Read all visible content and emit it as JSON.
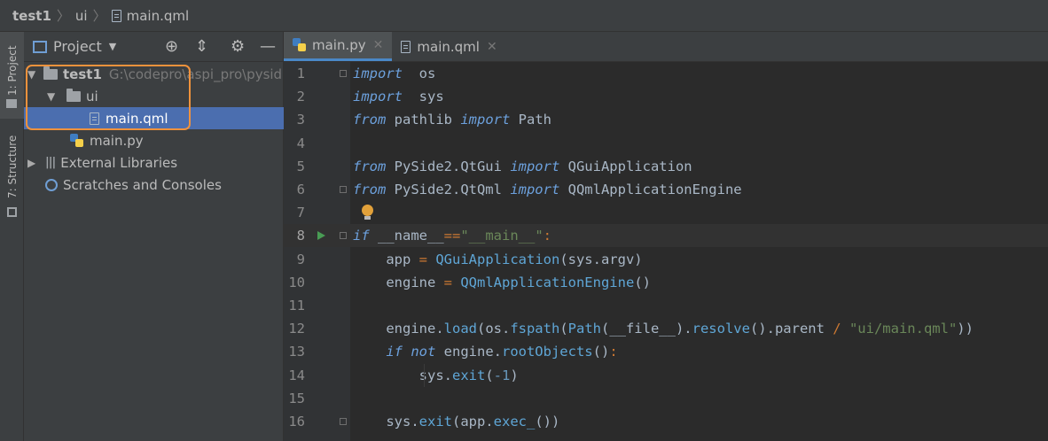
{
  "navbar": {
    "crumbs": [
      "test1",
      "ui",
      "main.qml"
    ]
  },
  "left_strip": {
    "project_tab": "1: Project",
    "structure_tab": "7: Structure"
  },
  "project_panel": {
    "title": "Project",
    "tree": [
      {
        "label": "test1",
        "path": "G:\\codepro\\aspi_pro\\pysid",
        "type": "folder",
        "expanded": true
      },
      {
        "label": "ui",
        "type": "folder",
        "expanded": true
      },
      {
        "label": "main.qml",
        "type": "file",
        "selected": true
      },
      {
        "label": "main.py",
        "type": "python"
      },
      {
        "label": "External Libraries",
        "type": "library",
        "expanded": false
      },
      {
        "label": "Scratches and Consoles",
        "type": "scratch"
      }
    ],
    "highlight_color": "#f0923c"
  },
  "editor": {
    "tabs": [
      {
        "label": "main.py",
        "active": true
      },
      {
        "label": "main.qml",
        "active": false
      }
    ],
    "current_line": 8,
    "line_numbers": [
      "1",
      "2",
      "3",
      "4",
      "5",
      "6",
      "7",
      "8",
      "9",
      "10",
      "11",
      "12",
      "13",
      "14",
      "15",
      "16"
    ],
    "lines": [
      [
        [
          "kwb",
          "import"
        ],
        [
          "",
          "  os"
        ]
      ],
      [
        [
          "kwb",
          "import"
        ],
        [
          "",
          "  sys"
        ]
      ],
      [
        [
          "kwb",
          "from"
        ],
        [
          "",
          " pathlib "
        ],
        [
          "kwb",
          "import"
        ],
        [
          "",
          " Path"
        ]
      ],
      [],
      [
        [
          "kwb",
          "from"
        ],
        [
          "",
          " PySide2.QtGui "
        ],
        [
          "kwb",
          "import"
        ],
        [
          "",
          " QGuiApplication"
        ]
      ],
      [
        [
          "kwb",
          "from"
        ],
        [
          "",
          " PySide2.QtQml "
        ],
        [
          "kwb",
          "import"
        ],
        [
          "",
          " QQmlApplicationEngine"
        ]
      ],
      [],
      [
        [
          "kwb",
          "if"
        ],
        [
          "",
          " __name__"
        ],
        [
          "kw",
          "=="
        ],
        [
          "str",
          "\"__main__\""
        ],
        [
          "kw",
          ":"
        ]
      ],
      [
        [
          "",
          "    app "
        ],
        [
          "kw",
          "="
        ],
        [
          "fn",
          " QGuiApplication"
        ],
        [
          "",
          "(sys.argv)"
        ]
      ],
      [
        [
          "",
          "    engine "
        ],
        [
          "kw",
          "="
        ],
        [
          "fn",
          " QQmlApplicationEngine"
        ],
        [
          "",
          "()"
        ]
      ],
      [],
      [
        [
          "",
          "    engine."
        ],
        [
          "fn",
          "load"
        ],
        [
          "",
          "(os."
        ],
        [
          "fn",
          "fspath"
        ],
        [
          "",
          "("
        ],
        [
          "fn",
          "Path"
        ],
        [
          "",
          "(__file__)."
        ],
        [
          "fn",
          "resolve"
        ],
        [
          "",
          "().parent "
        ],
        [
          "kw",
          "/"
        ],
        [
          "str",
          " \"ui/main.qml\""
        ],
        [
          "",
          "))"
        ]
      ],
      [
        [
          "kwb",
          "    if not"
        ],
        [
          "",
          " engine."
        ],
        [
          "fn",
          "rootObjects"
        ],
        [
          "",
          "()"
        ],
        [
          "kw",
          ":"
        ]
      ],
      [
        [
          "",
          "        sys."
        ],
        [
          "fn",
          "exit"
        ],
        [
          "",
          "("
        ],
        [
          "num",
          "-1"
        ],
        [
          "",
          ")"
        ]
      ],
      [],
      [
        [
          "",
          "    sys."
        ],
        [
          "fn",
          "exit"
        ],
        [
          "",
          "(app."
        ],
        [
          "fn",
          "exec_"
        ],
        [
          "",
          "())"
        ]
      ]
    ]
  }
}
